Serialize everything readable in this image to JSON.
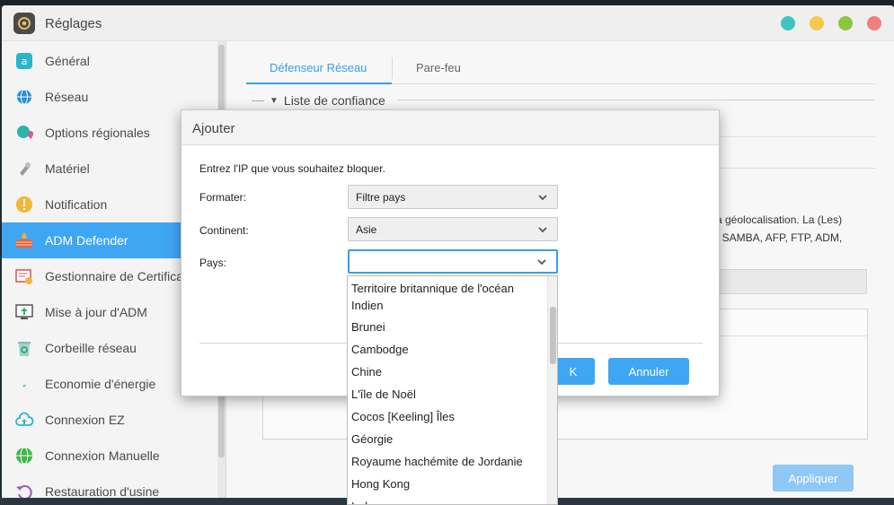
{
  "window": {
    "title": "Réglages"
  },
  "titlebar_dots": [
    "#3ec4c4",
    "#f2c94c",
    "#8cc63f",
    "#f07f7f"
  ],
  "sidebar": {
    "items": [
      {
        "label": "Général",
        "icon": "general-icon"
      },
      {
        "label": "Réseau",
        "icon": "globe-icon"
      },
      {
        "label": "Options régionales",
        "icon": "region-icon"
      },
      {
        "label": "Matériel",
        "icon": "hardware-icon"
      },
      {
        "label": "Notification",
        "icon": "notification-icon"
      },
      {
        "label": "ADM Defender",
        "icon": "firewall-icon"
      },
      {
        "label": "Gestionnaire de Certificat",
        "icon": "certificate-icon"
      },
      {
        "label": "Mise à jour d'ADM",
        "icon": "update-icon"
      },
      {
        "label": "Corbeille réseau",
        "icon": "recycle-icon"
      },
      {
        "label": "Economie d'énergie",
        "icon": "energy-icon"
      },
      {
        "label": "Connexion EZ",
        "icon": "cloud-icon"
      },
      {
        "label": "Connexion Manuelle",
        "icon": "manual-connect-icon"
      },
      {
        "label": "Restauration d'usine",
        "icon": "restore-icon"
      }
    ]
  },
  "content": {
    "tabs": [
      {
        "label": "Défenseur Réseau"
      },
      {
        "label": "Pare-feu"
      }
    ],
    "section_title": "Liste de confiance",
    "bg_text_1": "a géolocalisation. La (Les)",
    "bg_text_2": ": SAMBA, AFP, FTP, ADM,",
    "apply_label": "Appliquer"
  },
  "modal": {
    "title": "Ajouter",
    "description": "Entrez l'IP que vous souhaitez bloquer.",
    "format_label": "Formater:",
    "format_value": "Filtre pays",
    "continent_label": "Continent:",
    "continent_value": "Asie",
    "country_label": "Pays:",
    "country_value": "",
    "ok_label": "K",
    "cancel_label": "Annuler"
  },
  "dropdown": {
    "options": [
      "Territoire britannique de l'océan Indien",
      "Brunei",
      "Cambodge",
      "Chine",
      "L'île de Noël",
      "Cocos [Keeling] Îles",
      "Géorgie",
      "Royaume hachémite de Jordanie",
      "Hong Kong",
      "Inde"
    ]
  }
}
